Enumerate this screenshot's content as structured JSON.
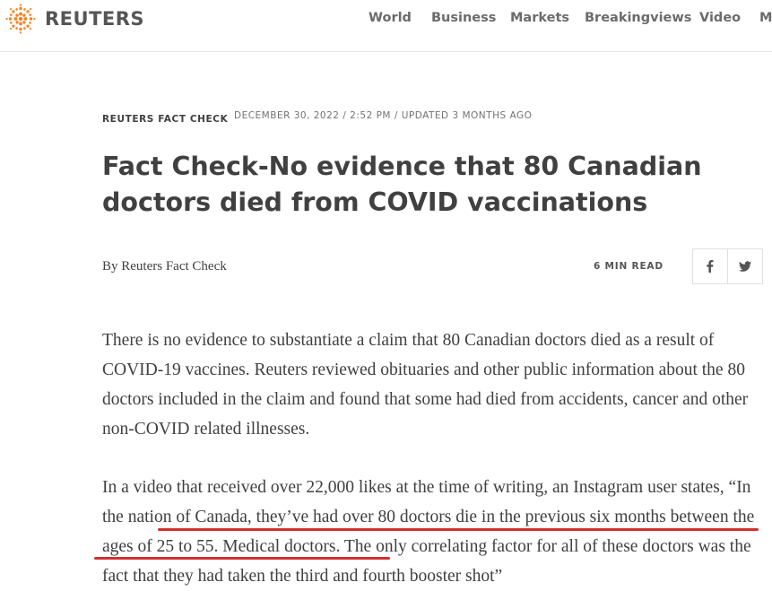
{
  "header": {
    "logo_text": "REUTERS",
    "nav": [
      "World",
      "Business",
      "Markets",
      "Breakingviews",
      "Video",
      "More"
    ]
  },
  "article": {
    "section": "REUTERS FACT CHECK",
    "dateline": "DECEMBER 30, 2022 / 2:52 PM / UPDATED 3 MONTHS AGO",
    "headline": "Fact Check-No evidence that 80 Canadian doctors died from COVID vaccinations",
    "byline": "By Reuters Fact Check",
    "read_time": "6 MIN READ",
    "share": {
      "facebook_icon": "facebook-icon",
      "twitter_icon": "twitter-icon"
    },
    "paragraph1": "There is no evidence to substantiate a claim that 80 Canadian doctors died as a result of COVID-19 vaccines. Reuters reviewed obituaries and other public information about the 80 doctors included in the claim and found that some had died from accidents, cancer and other non-COVID related illnesses.",
    "paragraph2_intro": "In a video that received over 22,000 likes at the time of writing, an Instagram user states, “In the nation of Canada, they’ve had over 80 doctors die in the previous six months between the ages of 25 to 55. Medical doctors. The only correlating factor for all of these doctors was the fact that they had taken the third and fourth booster shot”"
  },
  "colors": {
    "accent_orange": "#f58220",
    "annotation_red": "#d32f2f"
  }
}
